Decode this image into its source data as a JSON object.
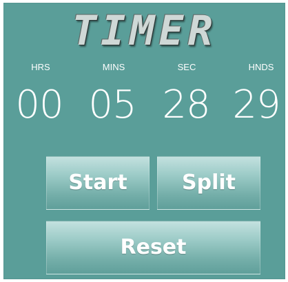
{
  "app": {
    "title": "TIMER"
  },
  "units": {
    "hours_label": "HRS",
    "minutes_label": "MINS",
    "seconds_label": "SEC",
    "hundredths_label": "HNDS"
  },
  "time": {
    "hours": "00",
    "minutes": "05",
    "seconds": "28",
    "hundredths": "29"
  },
  "buttons": {
    "start_label": "Start",
    "split_label": "Split",
    "reset_label": "Reset"
  },
  "colors": {
    "background": "#5a9e99",
    "text": "#ffffff",
    "button_top": "#c3e1df",
    "button_bottom": "#5f9f9a"
  }
}
